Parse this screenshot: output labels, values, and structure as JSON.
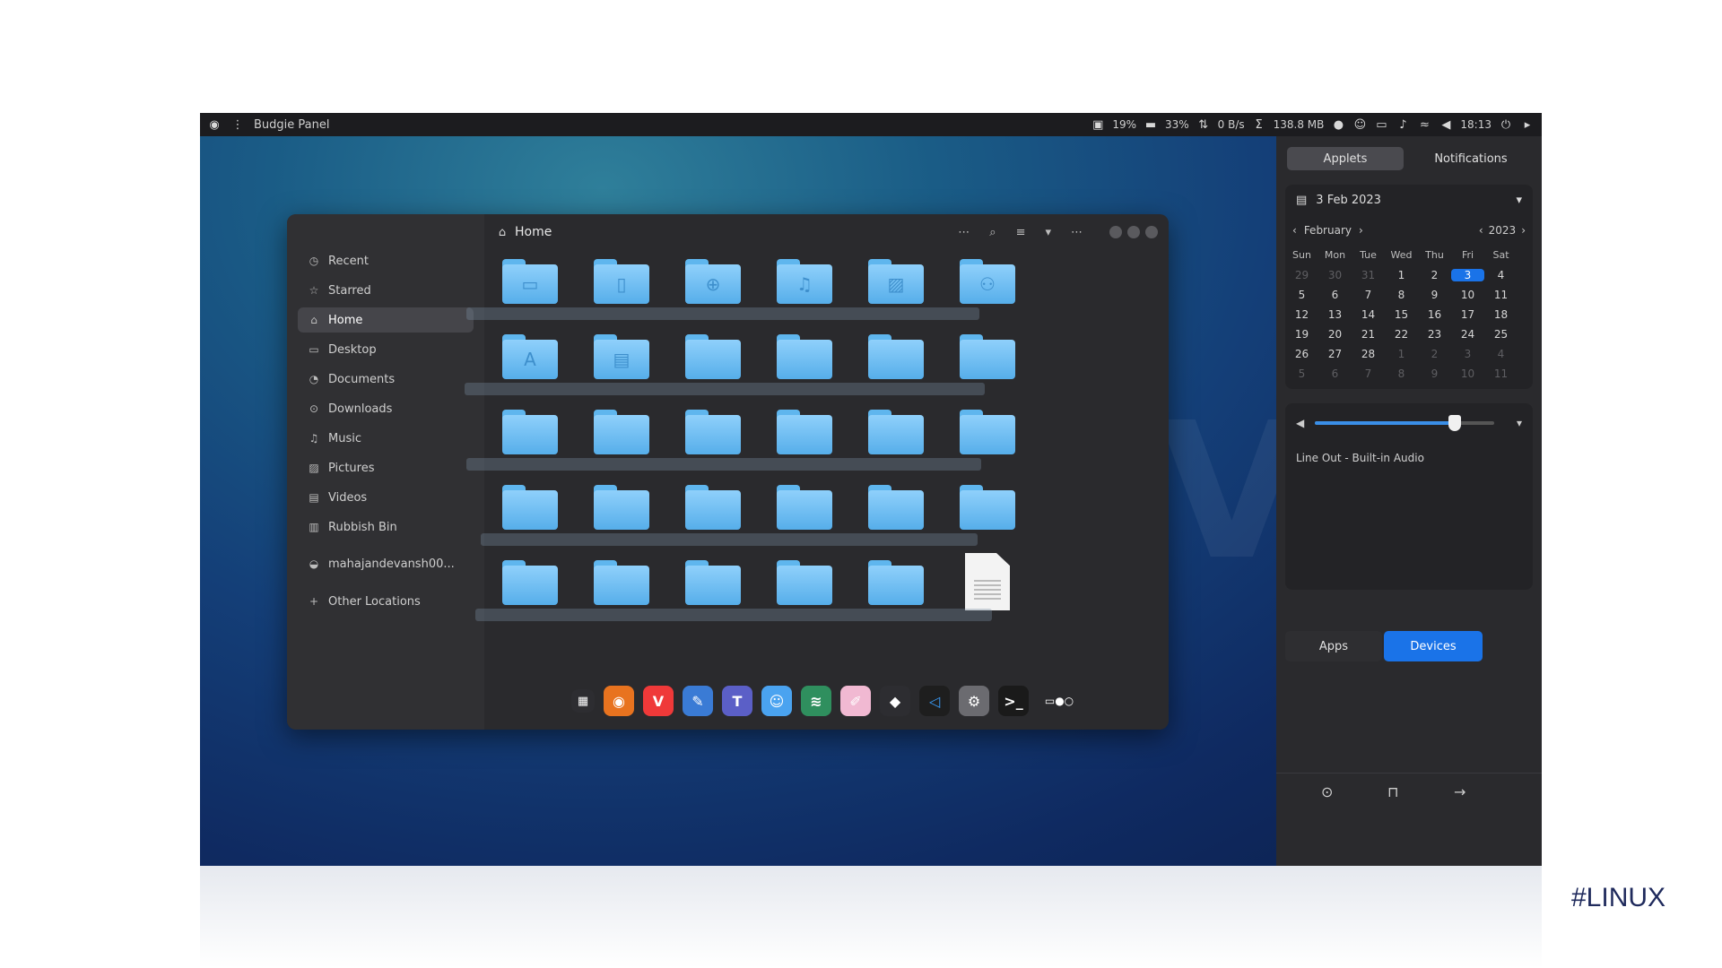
{
  "topbar": {
    "panel_title": "Budgie Panel",
    "cpu": "19%",
    "mem": "33%",
    "net": "0 B/s",
    "disk": "138.8 MB",
    "clock": "18:13"
  },
  "watermark": "NeuronVM",
  "file_manager": {
    "title": "Home",
    "sidebar": [
      {
        "label": "Recent",
        "icon": "clock-icon"
      },
      {
        "label": "Starred",
        "icon": "star-icon"
      },
      {
        "label": "Home",
        "icon": "home-icon",
        "active": true
      },
      {
        "label": "Desktop",
        "icon": "desktop-icon"
      },
      {
        "label": "Documents",
        "icon": "document-icon"
      },
      {
        "label": "Downloads",
        "icon": "download-icon"
      },
      {
        "label": "Music",
        "icon": "music-icon"
      },
      {
        "label": "Pictures",
        "icon": "picture-icon"
      },
      {
        "label": "Videos",
        "icon": "video-icon"
      },
      {
        "label": "Rubbish Bin",
        "icon": "trash-icon"
      },
      {
        "label": "mahajandevansh00...",
        "icon": "network-drive-icon"
      },
      {
        "label": "Other Locations",
        "icon": "plus-icon"
      }
    ]
  },
  "raven": {
    "tab_applets": "Applets",
    "tab_notifications": "Notifications",
    "date_header": "3 Feb 2023",
    "month": "February",
    "year": "2023",
    "weekdays": [
      "Sun",
      "Mon",
      "Tue",
      "Wed",
      "Thu",
      "Fri",
      "Sat"
    ],
    "weeks": [
      [
        "29",
        "30",
        "31",
        "1",
        "2",
        "3",
        "4"
      ],
      [
        "5",
        "6",
        "7",
        "8",
        "9",
        "10",
        "11"
      ],
      [
        "12",
        "13",
        "14",
        "15",
        "16",
        "17",
        "18"
      ],
      [
        "19",
        "20",
        "21",
        "22",
        "23",
        "24",
        "25"
      ],
      [
        "26",
        "27",
        "28",
        "1",
        "2",
        "3",
        "4"
      ],
      [
        "5",
        "6",
        "7",
        "8",
        "9",
        "10",
        "11"
      ]
    ],
    "selected_day": "3",
    "volume_level": 0.78,
    "audio_output": "Line Out - Built-in Audio",
    "tab_apps": "Apps",
    "tab_devices": "Devices"
  },
  "hashtag": "#LINUX"
}
